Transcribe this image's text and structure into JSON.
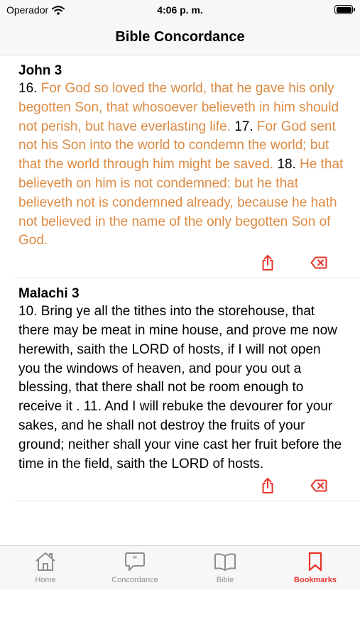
{
  "status_bar": {
    "carrier": "Operador",
    "time": "4:06 p. m."
  },
  "nav": {
    "title": "Bible Concordance"
  },
  "entries": [
    {
      "reference": "John 3",
      "highlighted": true,
      "v1_num": "16.",
      "v1_text": "For God so loved the world, that he gave his only begotten Son, that whosoever believeth in him should not perish, but have everlasting life.",
      "v2_num": "17.",
      "v2_text": "For God sent not his Son into the world to condemn the world; but that the world through him might be saved.",
      "v3_num": "18.",
      "v3_text": "He that believeth on him is not condemned: but he that believeth not is condemned already, because he hath not believed in the name of the only begotten Son of God."
    },
    {
      "reference": "Malachi 3",
      "highlighted": false,
      "text": "10. Bring ye all the tithes into the storehouse, that there may be meat in mine house, and prove me now herewith, saith the LORD of hosts, if I will not open you the windows of heaven, and pour you out a blessing, that there shall not be room enough to receive it . 11. And I will rebuke the devourer for your sakes, and he shall not destroy the fruits of your ground; neither shall your vine cast her fruit before the time in the field, saith the LORD of hosts."
    }
  ],
  "icons": {
    "share": "share-icon",
    "delete": "delete-backspace-icon"
  },
  "tabs": [
    {
      "label": "Home",
      "icon": "house-icon",
      "active": false
    },
    {
      "label": "Concordance",
      "icon": "quote-bubble-icon",
      "active": false
    },
    {
      "label": "Bible",
      "icon": "open-book-icon",
      "active": false
    },
    {
      "label": "Bookmarks",
      "icon": "bookmark-icon",
      "active": true
    }
  ],
  "colors": {
    "accent": "#e6342b",
    "verse_highlight": "#dd8a42",
    "inactive": "#8e8e8e",
    "bar_background": "#f7f7f7"
  }
}
